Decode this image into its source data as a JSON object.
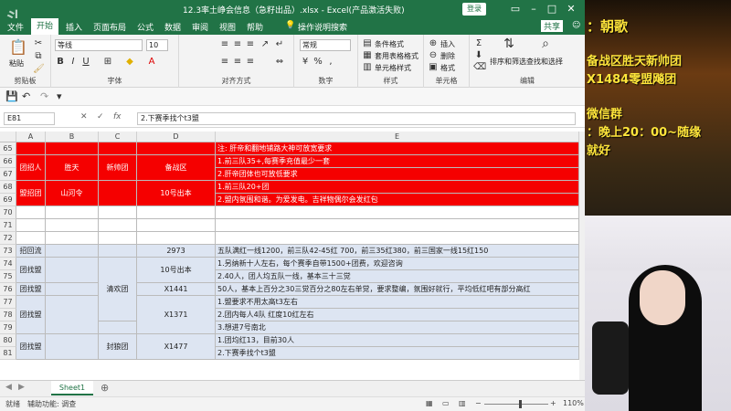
{
  "titlebar": {
    "title": "12.3率土峥会信息（急籽出品）.xlsx - Excel(产品激活失败)",
    "login": "登录"
  },
  "menu": [
    "文件",
    "开始",
    "插入",
    "页面布局",
    "公式",
    "数据",
    "审阅",
    "视图",
    "帮助",
    "操作说明搜索"
  ],
  "menu_active": "开始",
  "share": "共享",
  "ribbon": {
    "paste": "粘贴",
    "clipboard": "剪贴板",
    "font_name": "等线",
    "font_size": "10",
    "font_group": "字体",
    "align_group": "对齐方式",
    "number_format": "常规",
    "number_group": "数字",
    "cond_format": "条件格式",
    "table_format": "套用表格格式",
    "cell_style": "单元格样式",
    "style_group": "样式",
    "insert": "插入",
    "delete": "删除",
    "format": "格式",
    "cells_group": "单元格",
    "sort_filter": "排序和筛选",
    "find_select": "查找和选择",
    "edit_group": "编辑"
  },
  "namebox": "E81",
  "formula": "2.下赛季找个t3盟",
  "columns": [
    "A",
    "B",
    "C",
    "D",
    "E"
  ],
  "rows": {
    "65": {
      "E": "注: 肝帝和翻地铺路大神可放宽要求"
    },
    "66": {
      "A": "团招人",
      "B": "胜天",
      "C": "新帅团",
      "D": "备战区",
      "E": "1.前三队35+,每赛季充值最少一套"
    },
    "67": {
      "E": "2.肝帝团体也可放低要求"
    },
    "68": {
      "A": "盟招团",
      "B": "山河令",
      "D": "10号出本",
      "E": "1.前三队20+团"
    },
    "69": {
      "E": "2.盟内氛围和谐。为爱发电。吉祥物偶尔会发红包"
    },
    "73": {
      "A": "招回流",
      "D": "2973",
      "E": "五队满红一线1200，前三队42-45红 700，前三35红380，前三国家一线15红150"
    },
    "74": {
      "A": "团找盟",
      "C": "清欢团",
      "D": "10号出本",
      "E": "1.另纳新十人左右，每个赛季自带1500+团费，欢迎咨询"
    },
    "75": {
      "E": "2.40人，团人均五队一线，基本三十三觉"
    },
    "76": {
      "A": "团找盟",
      "D": "X1441",
      "E": "50人，基本上百分之30三觉百分之80左右单觉，要求整编，氛围好就行，平均低红吧有部分高红"
    },
    "77": {
      "E": "1.盟要求不用太高t3左右"
    },
    "78": {
      "A": "团找盟",
      "C": "江山团",
      "D": "X1371",
      "E": "2.团内每人4队 红度10红左右"
    },
    "79": {
      "E": "3.想进7号南北"
    },
    "80": {
      "E": "1.团均红13，目前30人"
    },
    "81": {
      "A": "团找盟",
      "C": "封狼团",
      "D": "X1477",
      "E": "2.下赛季找个t3盟"
    }
  },
  "row_numbers": [
    "65",
    "66",
    "67",
    "68",
    "69",
    "70",
    "71",
    "72",
    "73",
    "74",
    "75",
    "76",
    "77",
    "78",
    "79",
    "80",
    "81"
  ],
  "sheet_tab": "Sheet1",
  "status": {
    "ready": "就绪",
    "accessibility": "辅助功能: 调查",
    "zoom": "110%"
  },
  "stream": {
    "host": "：朝歌",
    "line1": "备战区胜天新帅团",
    "line2": "X1484零盟飚团",
    "line3": "微信群",
    "line4": "：晚上20：00~随缘",
    "line5": "就好"
  },
  "colors": {
    "excel_green": "#217346",
    "red_fill": "#f50000",
    "blue_fill": "#dde5f2",
    "overlay_yellow": "#ffe53b"
  }
}
